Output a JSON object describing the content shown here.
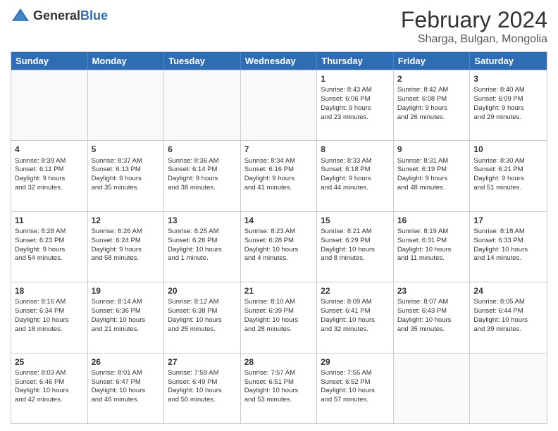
{
  "header": {
    "logo_general": "General",
    "logo_blue": "Blue",
    "title": "February 2024",
    "location": "Sharga, Bulgan, Mongolia"
  },
  "calendar": {
    "days_of_week": [
      "Sunday",
      "Monday",
      "Tuesday",
      "Wednesday",
      "Thursday",
      "Friday",
      "Saturday"
    ],
    "weeks": [
      [
        {
          "day": "",
          "empty": true
        },
        {
          "day": "",
          "empty": true
        },
        {
          "day": "",
          "empty": true
        },
        {
          "day": "",
          "empty": true
        },
        {
          "day": "1",
          "line1": "Sunrise: 8:43 AM",
          "line2": "Sunset: 6:06 PM",
          "line3": "Daylight: 9 hours",
          "line4": "and 23 minutes."
        },
        {
          "day": "2",
          "line1": "Sunrise: 8:42 AM",
          "line2": "Sunset: 6:08 PM",
          "line3": "Daylight: 9 hours",
          "line4": "and 26 minutes."
        },
        {
          "day": "3",
          "line1": "Sunrise: 8:40 AM",
          "line2": "Sunset: 6:09 PM",
          "line3": "Daylight: 9 hours",
          "line4": "and 29 minutes."
        }
      ],
      [
        {
          "day": "4",
          "line1": "Sunrise: 8:39 AM",
          "line2": "Sunset: 6:11 PM",
          "line3": "Daylight: 9 hours",
          "line4": "and 32 minutes."
        },
        {
          "day": "5",
          "line1": "Sunrise: 8:37 AM",
          "line2": "Sunset: 6:13 PM",
          "line3": "Daylight: 9 hours",
          "line4": "and 35 minutes."
        },
        {
          "day": "6",
          "line1": "Sunrise: 8:36 AM",
          "line2": "Sunset: 6:14 PM",
          "line3": "Daylight: 9 hours",
          "line4": "and 38 minutes."
        },
        {
          "day": "7",
          "line1": "Sunrise: 8:34 AM",
          "line2": "Sunset: 6:16 PM",
          "line3": "Daylight: 9 hours",
          "line4": "and 41 minutes."
        },
        {
          "day": "8",
          "line1": "Sunrise: 8:33 AM",
          "line2": "Sunset: 6:18 PM",
          "line3": "Daylight: 9 hours",
          "line4": "and 44 minutes."
        },
        {
          "day": "9",
          "line1": "Sunrise: 8:31 AM",
          "line2": "Sunset: 6:19 PM",
          "line3": "Daylight: 9 hours",
          "line4": "and 48 minutes."
        },
        {
          "day": "10",
          "line1": "Sunrise: 8:30 AM",
          "line2": "Sunset: 6:21 PM",
          "line3": "Daylight: 9 hours",
          "line4": "and 51 minutes."
        }
      ],
      [
        {
          "day": "11",
          "line1": "Sunrise: 8:28 AM",
          "line2": "Sunset: 6:23 PM",
          "line3": "Daylight: 9 hours",
          "line4": "and 54 minutes."
        },
        {
          "day": "12",
          "line1": "Sunrise: 8:26 AM",
          "line2": "Sunset: 6:24 PM",
          "line3": "Daylight: 9 hours",
          "line4": "and 58 minutes."
        },
        {
          "day": "13",
          "line1": "Sunrise: 8:25 AM",
          "line2": "Sunset: 6:26 PM",
          "line3": "Daylight: 10 hours",
          "line4": "and 1 minute."
        },
        {
          "day": "14",
          "line1": "Sunrise: 8:23 AM",
          "line2": "Sunset: 6:28 PM",
          "line3": "Daylight: 10 hours",
          "line4": "and 4 minutes."
        },
        {
          "day": "15",
          "line1": "Sunrise: 8:21 AM",
          "line2": "Sunset: 6:29 PM",
          "line3": "Daylight: 10 hours",
          "line4": "and 8 minutes."
        },
        {
          "day": "16",
          "line1": "Sunrise: 8:19 AM",
          "line2": "Sunset: 6:31 PM",
          "line3": "Daylight: 10 hours",
          "line4": "and 11 minutes."
        },
        {
          "day": "17",
          "line1": "Sunrise: 8:18 AM",
          "line2": "Sunset: 6:33 PM",
          "line3": "Daylight: 10 hours",
          "line4": "and 14 minutes."
        }
      ],
      [
        {
          "day": "18",
          "line1": "Sunrise: 8:16 AM",
          "line2": "Sunset: 6:34 PM",
          "line3": "Daylight: 10 hours",
          "line4": "and 18 minutes."
        },
        {
          "day": "19",
          "line1": "Sunrise: 8:14 AM",
          "line2": "Sunset: 6:36 PM",
          "line3": "Daylight: 10 hours",
          "line4": "and 21 minutes."
        },
        {
          "day": "20",
          "line1": "Sunrise: 8:12 AM",
          "line2": "Sunset: 6:38 PM",
          "line3": "Daylight: 10 hours",
          "line4": "and 25 minutes."
        },
        {
          "day": "21",
          "line1": "Sunrise: 8:10 AM",
          "line2": "Sunset: 6:39 PM",
          "line3": "Daylight: 10 hours",
          "line4": "and 28 minutes."
        },
        {
          "day": "22",
          "line1": "Sunrise: 8:09 AM",
          "line2": "Sunset: 6:41 PM",
          "line3": "Daylight: 10 hours",
          "line4": "and 32 minutes."
        },
        {
          "day": "23",
          "line1": "Sunrise: 8:07 AM",
          "line2": "Sunset: 6:43 PM",
          "line3": "Daylight: 10 hours",
          "line4": "and 35 minutes."
        },
        {
          "day": "24",
          "line1": "Sunrise: 8:05 AM",
          "line2": "Sunset: 6:44 PM",
          "line3": "Daylight: 10 hours",
          "line4": "and 39 minutes."
        }
      ],
      [
        {
          "day": "25",
          "line1": "Sunrise: 8:03 AM",
          "line2": "Sunset: 6:46 PM",
          "line3": "Daylight: 10 hours",
          "line4": "and 42 minutes."
        },
        {
          "day": "26",
          "line1": "Sunrise: 8:01 AM",
          "line2": "Sunset: 6:47 PM",
          "line3": "Daylight: 10 hours",
          "line4": "and 46 minutes."
        },
        {
          "day": "27",
          "line1": "Sunrise: 7:59 AM",
          "line2": "Sunset: 6:49 PM",
          "line3": "Daylight: 10 hours",
          "line4": "and 50 minutes."
        },
        {
          "day": "28",
          "line1": "Sunrise: 7:57 AM",
          "line2": "Sunset: 6:51 PM",
          "line3": "Daylight: 10 hours",
          "line4": "and 53 minutes."
        },
        {
          "day": "29",
          "line1": "Sunrise: 7:55 AM",
          "line2": "Sunset: 6:52 PM",
          "line3": "Daylight: 10 hours",
          "line4": "and 57 minutes."
        },
        {
          "day": "",
          "empty": true
        },
        {
          "day": "",
          "empty": true
        }
      ]
    ]
  }
}
